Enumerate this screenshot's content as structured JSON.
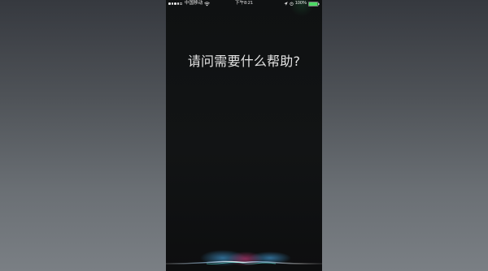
{
  "status_bar": {
    "carrier": "中国移动",
    "time": "下午8:21",
    "battery_percent_label": "100%",
    "battery_level": 1.0,
    "battery_color": "#4cd964"
  },
  "siri": {
    "prompt": "请问需要什么帮助?"
  },
  "colors": {
    "screen_background": "#111314",
    "wave_blue": "#4db8ff",
    "wave_pink": "#ff4fa3",
    "wave_teal": "#5ef0e0"
  },
  "icons": [
    "signal-dots-icon",
    "wifi-icon",
    "location-icon",
    "alarm-icon",
    "battery-icon",
    "siri-waveform-icon"
  ]
}
